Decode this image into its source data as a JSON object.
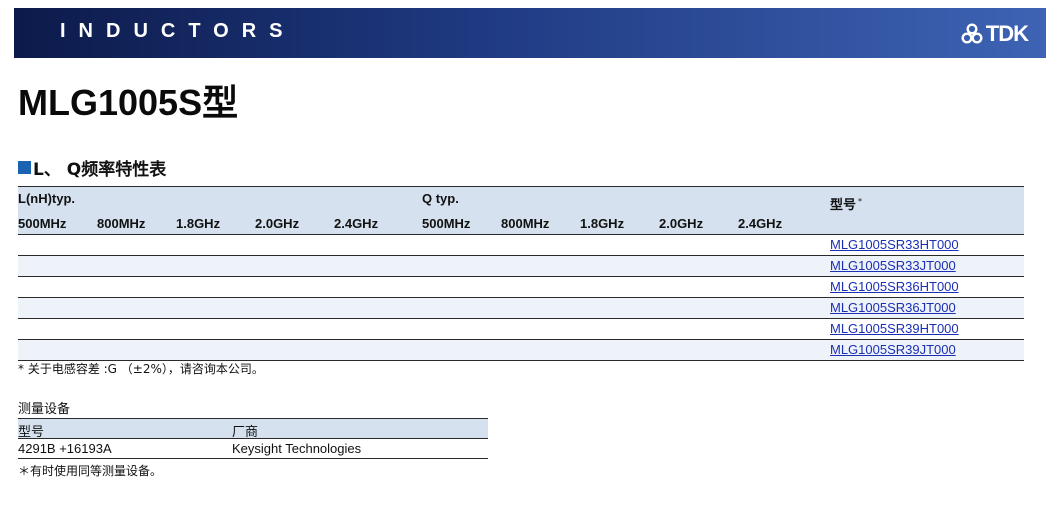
{
  "header": {
    "banner_title": "INDUCTORS",
    "brand": "TDK",
    "banner_color": "#1f3a82",
    "brand_icon": "tdk-logo-icon"
  },
  "product": {
    "title": "MLG1005S型"
  },
  "section": {
    "title": "L、 Q频率特性表",
    "marker_color": "#1c62b3"
  },
  "table": {
    "group_l": "L(nH)typ.",
    "group_q": "Q typ.",
    "freqs_l": [
      "500MHz",
      "800MHz",
      "1.8GHz",
      "2.0GHz",
      "2.4GHz"
    ],
    "freqs_q": [
      "500MHz",
      "800MHz",
      "1.8GHz",
      "2.0GHz",
      "2.4GHz"
    ],
    "model_header": "型号",
    "model_header_mark": "*",
    "header_bg": "#d5e1ef",
    "rows": [
      "MLG1005SR33HT000",
      "MLG1005SR33JT000",
      "MLG1005SR36HT000",
      "MLG1005SR36JT000",
      "MLG1005SR39HT000",
      "MLG1005SR39JT000"
    ]
  },
  "footnote": "* 关于电感容差 :G （±2%），请咨询本公司。",
  "equipment": {
    "title": "测量设备",
    "col_model": "型号",
    "col_maker": "厂商",
    "rows": [
      {
        "model": "4291B +16193A",
        "maker": "Keysight Technologies"
      }
    ],
    "note": "＊有时使用同等测量设备。"
  }
}
